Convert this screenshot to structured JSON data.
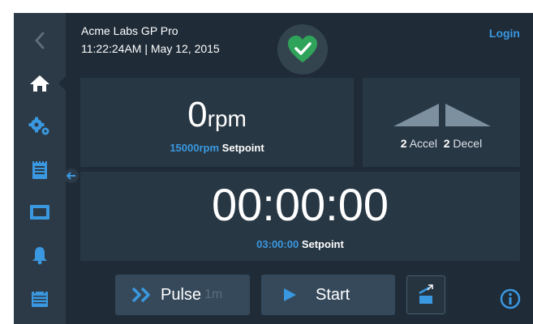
{
  "header": {
    "device_name": "Acme Labs GP Pro",
    "datetime": "11:22:24AM | May 12, 2015",
    "login_label": "Login",
    "status_icon": "heart-check-icon"
  },
  "sidebar": {
    "items": [
      {
        "name": "back",
        "icon": "chevron-left-icon"
      },
      {
        "name": "home",
        "icon": "home-icon",
        "active": true
      },
      {
        "name": "settings",
        "icon": "gears-icon"
      },
      {
        "name": "notes",
        "icon": "notepad-icon"
      },
      {
        "name": "display",
        "icon": "screen-icon"
      },
      {
        "name": "alarms",
        "icon": "bell-icon"
      },
      {
        "name": "calendar",
        "icon": "calendar-icon"
      }
    ],
    "collapse_icon": "arrow-left-icon"
  },
  "speed": {
    "value": "0",
    "unit": "rpm",
    "setpoint_value": "15000rpm",
    "setpoint_label": "Setpoint"
  },
  "ramp": {
    "accel_value": "2",
    "accel_label": "Accel",
    "decel_value": "2",
    "decel_label": "Decel"
  },
  "timer": {
    "value": "00:00:00",
    "setpoint_value": "03:00:00",
    "setpoint_label": "Setpoint"
  },
  "controls": {
    "pulse_label": "Pulse",
    "pulse_sub": "1m",
    "start_label": "Start",
    "lid_icon": "lid-open-icon",
    "info_icon": "info-icon"
  },
  "colors": {
    "background": "#1f2b37",
    "sidebar": "#2c3947",
    "panel": "#283744",
    "button": "#36495a",
    "accent": "#3a98e0",
    "status_green": "#2fa35a"
  }
}
